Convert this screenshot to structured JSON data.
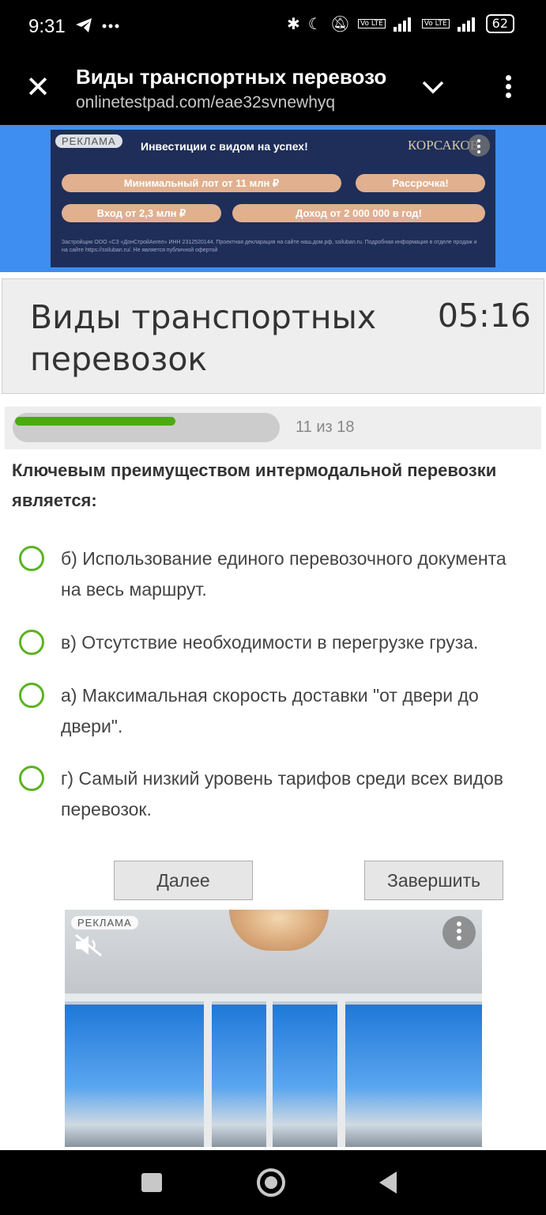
{
  "status_bar": {
    "time": "9:31",
    "battery": "62",
    "network": "4G+",
    "lte": "Vo LTE"
  },
  "browser": {
    "title": "Виды транспортных перевозо",
    "url": "onlinetestpad.com/eae32svnewhyq"
  },
  "ad_top": {
    "label": "РЕКЛАМА",
    "headline": "Инвестиции с видом на успех!",
    "brand": "КОРСАКОВ",
    "pills": [
      "Минимальный лот от 11 млн ₽",
      "Рассрочка!",
      "Вход от 2,3 млн ₽",
      "Доход от 2 000 000 в год!"
    ],
    "fine_print": "Застройщик ООО «СЗ «ДонСтройАнгел» ИНН 2312520144. Проектная декларация на сайте наш.дом.рф, ssiluban.ru. Подробная информация в отделе продаж и на сайте https://ssiluban.ru/. Не является публичной офертой"
  },
  "test": {
    "title": "Виды транспортных перевозок",
    "timer": "05:16",
    "progress_text": "11 из 18",
    "progress_current": 11,
    "progress_total": 18,
    "question": "Ключевым преимуществом интермодальной перевозки является:",
    "options": [
      "б) Использование единого перевозочного документа на весь маршрут.",
      "в) Отсутствие необходимости в перегрузке груза.",
      "а) Максимальная скорость доставки \"от двери до двери\".",
      "г) Самый низкий уровень тарифов среди всех видов перевозок."
    ],
    "next_label": "Далее",
    "finish_label": "Завершить"
  },
  "ad_bottom": {
    "label": "РЕКЛАМА"
  },
  "colors": {
    "accent_green": "#5cb321",
    "progress_green": "#4aaa0f",
    "ad_blue": "#3d8ef0"
  }
}
